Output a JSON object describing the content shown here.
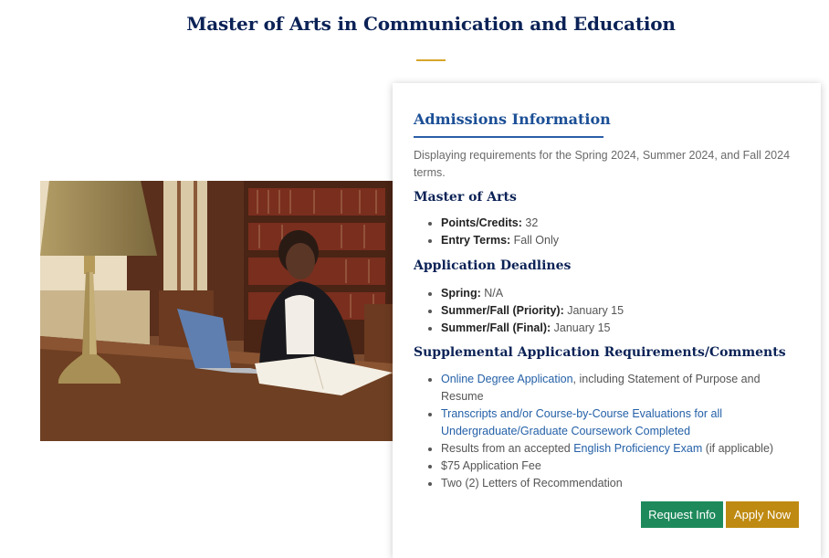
{
  "page": {
    "title": "Master of Arts in Communication and Education",
    "accent_color": "#d7a62b"
  },
  "photo": {
    "description_icon": "photo-woman-studying-in-library"
  },
  "admissions": {
    "heading": "Admissions Information",
    "intro": "Displaying requirements for the Spring 2024, Summer 2024, and Fall 2024 terms.",
    "degree": {
      "title": "Master of Arts",
      "items": [
        {
          "label": "Points/Credits:",
          "value": "32"
        },
        {
          "label": "Entry Terms:",
          "value": "Fall Only"
        }
      ]
    },
    "deadlines": {
      "title": "Application Deadlines",
      "items": [
        {
          "label": "Spring:",
          "value": "N/A"
        },
        {
          "label": "Summer/Fall (Priority):",
          "value": "January 15"
        },
        {
          "label": "Summer/Fall (Final):",
          "value": "January 15"
        }
      ]
    },
    "supplemental": {
      "title": "Supplemental Application Requirements/Comments",
      "items": [
        {
          "link": "Online Degree Application",
          "text": ", including Statement of Purpose and Resume"
        },
        {
          "link": "Transcripts and/or Course-by-Course Evaluations for all Undergraduate/Graduate Coursework Completed",
          "text": ""
        },
        {
          "pre": "Results from an accepted ",
          "link": "English Proficiency Exam",
          "text": " (if applicable)"
        },
        {
          "text": "$75 Application Fee"
        },
        {
          "text": "Two (2) Letters of Recommendation"
        }
      ]
    },
    "buttons": {
      "request_info": "Request Info",
      "apply_now": "Apply Now",
      "request_color": "#1e8a5c",
      "apply_color": "#bf8a12"
    }
  }
}
